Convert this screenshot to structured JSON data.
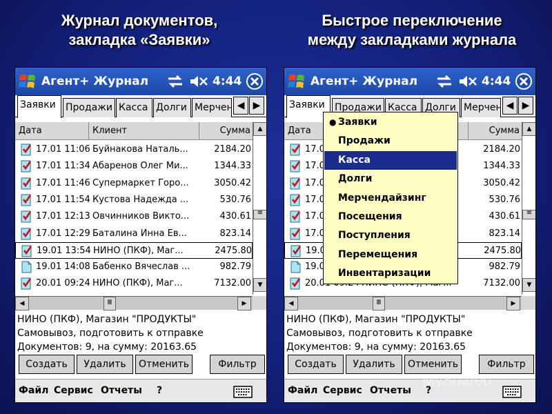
{
  "slide": {
    "left_heading": [
      "Журнал документов,",
      "закладка «Заявки»"
    ],
    "right_heading": [
      "Быстрое переключение",
      "между закладками журнала"
    ],
    "watermark": "MyShared",
    "bg_color": "#13207a"
  },
  "device": {
    "app_title": "Агент+ Журнал",
    "clock": "4:44",
    "icons": [
      "windows-logo-icon",
      "sync-icon",
      "speaker-icon",
      "close-icon"
    ],
    "tabs": [
      "Заявки",
      "Продажи",
      "Касса",
      "Долги",
      "Мерчен"
    ],
    "columns": [
      "Дата",
      "Клиент",
      "Сумма"
    ],
    "rows": [
      {
        "date": "17.01 11:06",
        "client": "Буйнакова Наталь...",
        "sum": "2184.20",
        "icon": "checked-doc-icon"
      },
      {
        "date": "17.01 11:34",
        "client": "Абаренов Олег Ми...",
        "sum": "1344.33",
        "icon": "checked-doc-icon"
      },
      {
        "date": "17.01 11:46",
        "client": "Супермаркет Горо...",
        "sum": "3050.42",
        "icon": "checked-doc-icon"
      },
      {
        "date": "17.01 11:54",
        "client": "Кустова Надежда ...",
        "sum": "530.76",
        "icon": "checked-doc-icon"
      },
      {
        "date": "17.01 12:13",
        "client": "Овчинников Викто...",
        "sum": "430.61",
        "icon": "checked-doc-icon"
      },
      {
        "date": "17.01 12:29",
        "client": "Баталина Инна Ев...",
        "sum": "823.14",
        "icon": "checked-doc-icon"
      },
      {
        "date": "19.01 13:54",
        "client": "НИНО (ПКФ), Маг...",
        "sum": "2475.80",
        "icon": "checked-doc-icon",
        "selected": true
      },
      {
        "date": "19.01 14:08",
        "client": "Бабенко Вячеслав ...",
        "sum": "982.79",
        "icon": "blank-doc-icon"
      },
      {
        "date": "20.01 09:24",
        "client": "НИНО (ПКФ), Маг...",
        "sum": "7132.00",
        "icon": "checked-doc-icon"
      }
    ],
    "info_lines": [
      "НИНО (ПКФ), Магазин \"ПРОДУКТЫ\"",
      "Самовывоз, подготовить к отправке",
      "Документов: 9, на сумму: 20163.65"
    ],
    "buttons": [
      "Создать",
      "Удалить",
      "Отменить",
      "Фильтр"
    ],
    "menu": [
      "Файл",
      "Сервис",
      "Отчеты",
      "?"
    ],
    "dropdown_items": [
      "Заявки",
      "Продажи",
      "Касса",
      "Долги",
      "Мерчендайзинг",
      "Посещения",
      "Поступления",
      "Перемещения",
      "Инвентаризации"
    ],
    "dropdown_checked": "Заявки",
    "dropdown_highlighted": "Касса"
  }
}
